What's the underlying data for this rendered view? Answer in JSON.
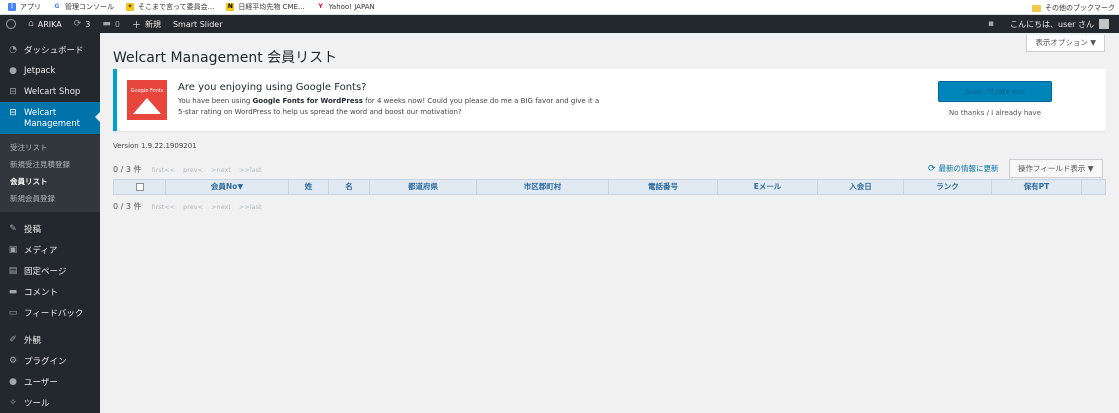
{
  "bookmarks": {
    "items": [
      {
        "label": "アプリ",
        "icon": "apps-grid-icon"
      },
      {
        "label": "管理コンソール",
        "icon": "google-g-icon"
      },
      {
        "label": "そこまで言って委員会...",
        "icon": "yellow-site-icon"
      },
      {
        "label": "日経平均先物 CME...",
        "icon": "nk-icon"
      },
      {
        "label": "Yahoo! JAPAN",
        "icon": "yahoo-icon"
      }
    ],
    "other": "その他のブックマーク"
  },
  "adminbar": {
    "site": "ARIKA",
    "updates": "3",
    "comments": "0",
    "new": "新規",
    "plugin": "Smart Slider",
    "greeting": "こんにちは、user さん"
  },
  "sidebar": {
    "items": [
      {
        "label": "ダッシュボード",
        "icon": "dashboard-icon"
      },
      {
        "label": "Jetpack",
        "icon": "jetpack-icon"
      },
      {
        "label": "Welcart Shop",
        "icon": "cart-icon"
      },
      {
        "label": "Welcart Management",
        "icon": "cart-icon"
      }
    ],
    "submenu": [
      "受注リスト",
      "新規受注見積登録",
      "会員リスト",
      "新規会員登録"
    ],
    "items2": [
      {
        "label": "投稿",
        "icon": "pin-icon"
      },
      {
        "label": "メディア",
        "icon": "media-icon"
      },
      {
        "label": "固定ページ",
        "icon": "page-icon"
      },
      {
        "label": "コメント",
        "icon": "comment-icon"
      },
      {
        "label": "フィードバック",
        "icon": "feedback-icon"
      }
    ],
    "items3": [
      {
        "label": "外観",
        "icon": "brush-icon"
      },
      {
        "label": "プラグイン",
        "icon": "plugin-icon"
      },
      {
        "label": "ユーザー",
        "icon": "user-icon"
      },
      {
        "label": "ツール",
        "icon": "wrench-icon"
      }
    ]
  },
  "main": {
    "screen_options": "表示オプション ▼",
    "title": "Welcart Management 会員リスト",
    "notice": {
      "logo_text": "Google Fonts",
      "title": "Are you enjoying using Google Fonts?",
      "body_pre": "You have been using ",
      "body_bold": "Google Fonts for WordPress",
      "body_post": " for 4 weeks now! Could you please do me a BIG favor and give it a 5-star rating on WordPress to help us spread the word and boost our motivation?",
      "button": "Sure, I'll rate you",
      "dismiss": "No thanks / I already have"
    },
    "version": "Version 1.9.22.1909201",
    "count": "0 / 3 件",
    "pager": [
      "first<<",
      "prev<",
      ">next",
      ">>last"
    ],
    "refresh": "最新の情報に更新",
    "fields_button": "操作フィールド表示 ▼",
    "columns": [
      "",
      "会員No▼",
      "姓",
      "名",
      "都道府県",
      "市区郡町村",
      "電話番号",
      "Eメール",
      "入会日",
      "ランク",
      "保有PT",
      ""
    ]
  }
}
